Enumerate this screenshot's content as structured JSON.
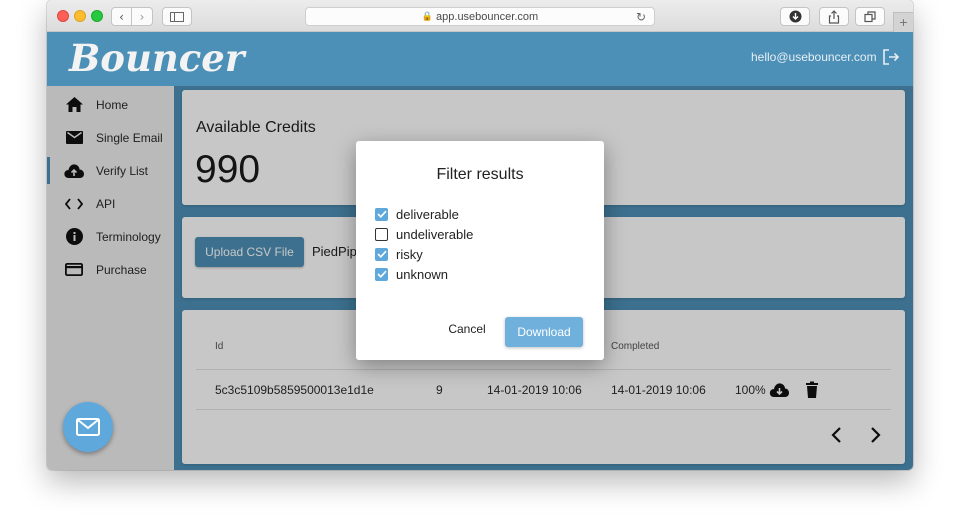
{
  "browser": {
    "url": "app.usebouncer.com"
  },
  "header": {
    "logo": "Bouncer",
    "user_email": "hello@usebouncer.com"
  },
  "sidebar": {
    "items": [
      {
        "label": "Home",
        "icon": "home-icon"
      },
      {
        "label": "Single Email",
        "icon": "envelope-icon"
      },
      {
        "label": "Verify List",
        "icon": "cloud-upload-icon",
        "active": true
      },
      {
        "label": "API",
        "icon": "code-icon"
      },
      {
        "label": "Terminology",
        "icon": "info-icon"
      },
      {
        "label": "Purchase",
        "icon": "credit-card-icon"
      }
    ]
  },
  "credits": {
    "title": "Available Credits",
    "value": "990"
  },
  "upload": {
    "button_label": "Upload CSV File",
    "filename": "PiedPip"
  },
  "table": {
    "headers": {
      "id": "Id",
      "completed": "Completed"
    },
    "rows": [
      {
        "id": "5c3c5109b5859500013e1d1e",
        "count": "9",
        "created": "14-01-2019 10:06",
        "completed": "14-01-2019 10:06",
        "progress": "100%"
      }
    ]
  },
  "dialog": {
    "title": "Filter results",
    "options": [
      {
        "label": "deliverable",
        "checked": true
      },
      {
        "label": "undeliverable",
        "checked": false
      },
      {
        "label": "risky",
        "checked": true
      },
      {
        "label": "unknown",
        "checked": true
      }
    ],
    "cancel_label": "Cancel",
    "download_label": "Download"
  },
  "colors": {
    "brand": "#4d90b7",
    "accent": "#5fa8dc"
  }
}
